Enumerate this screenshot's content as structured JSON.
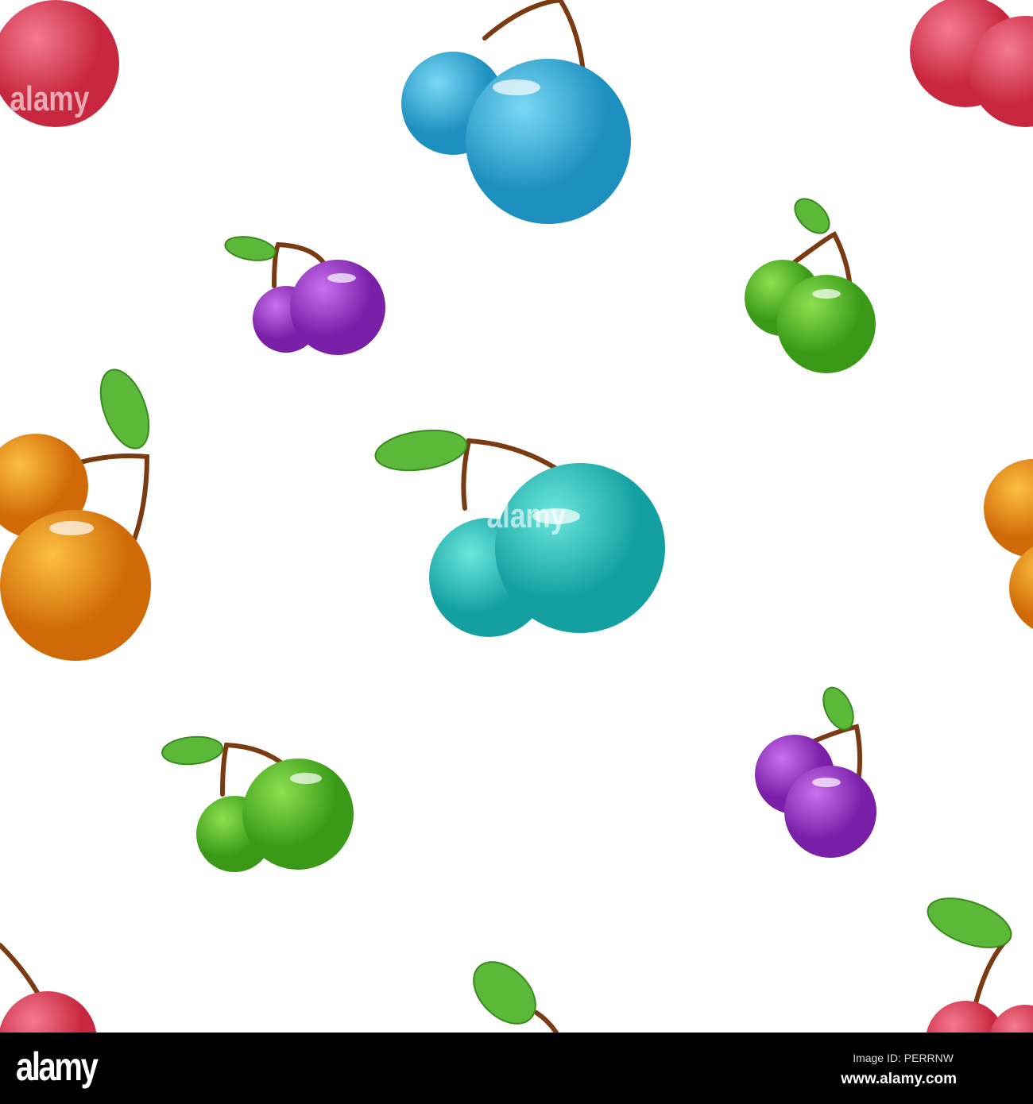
{
  "watermark": {
    "logo": "alamy",
    "image_id": "Image ID: PERRNW",
    "url": "www.alamy.com"
  },
  "colors": {
    "pink": "#e8506a",
    "blue": "#3cb8e0",
    "purple": "#a03cd0",
    "green": "#5cc030",
    "orange": "#f0a020",
    "teal": "#30c8c0",
    "leaf": "#5cb838",
    "stem": "#7a3a12"
  }
}
